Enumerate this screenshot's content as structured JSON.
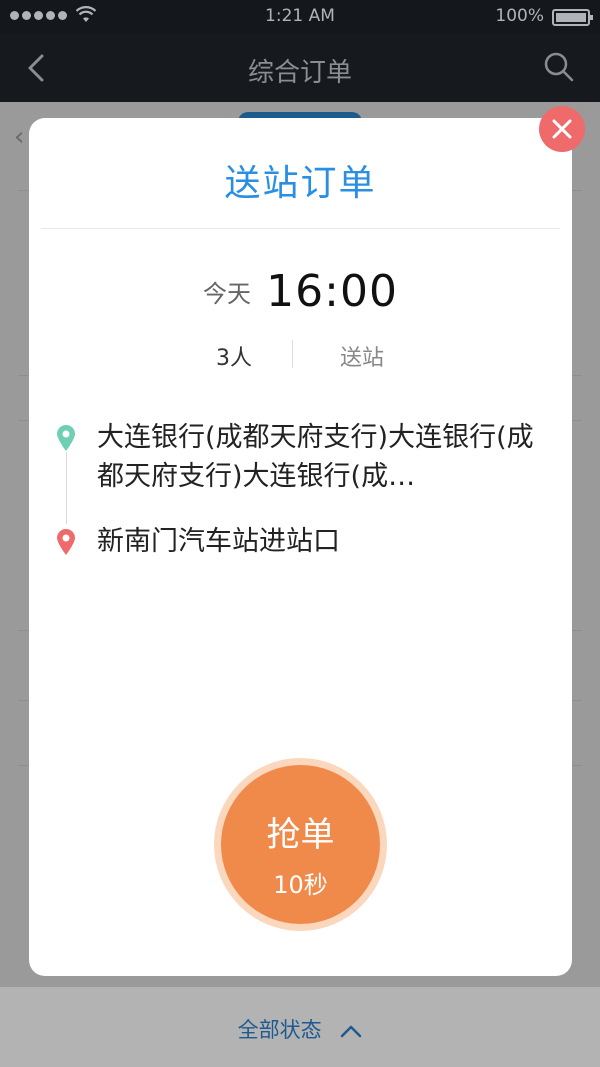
{
  "status_bar": {
    "time": "1:21 AM",
    "battery": "100%"
  },
  "nav": {
    "title": "综合订单"
  },
  "modal": {
    "title": "送站订单",
    "day": "今天",
    "time": "16:00",
    "passengers": "3人",
    "order_type": "送站",
    "from": "大连银行(成都天府支行)大连银行(成都天府支行)大连银行(成…",
    "to": "新南门汽车站进站口",
    "grab_button": {
      "label": "抢单",
      "countdown": "10秒"
    }
  },
  "bottom_bar": {
    "filter_label": "全部状态"
  },
  "colors": {
    "accent": "#2a8ee3",
    "grab": "#f08a4b",
    "close": "#ef6b6b",
    "start_pin": "#6ecfb3",
    "end_pin": "#ef6b6b"
  }
}
